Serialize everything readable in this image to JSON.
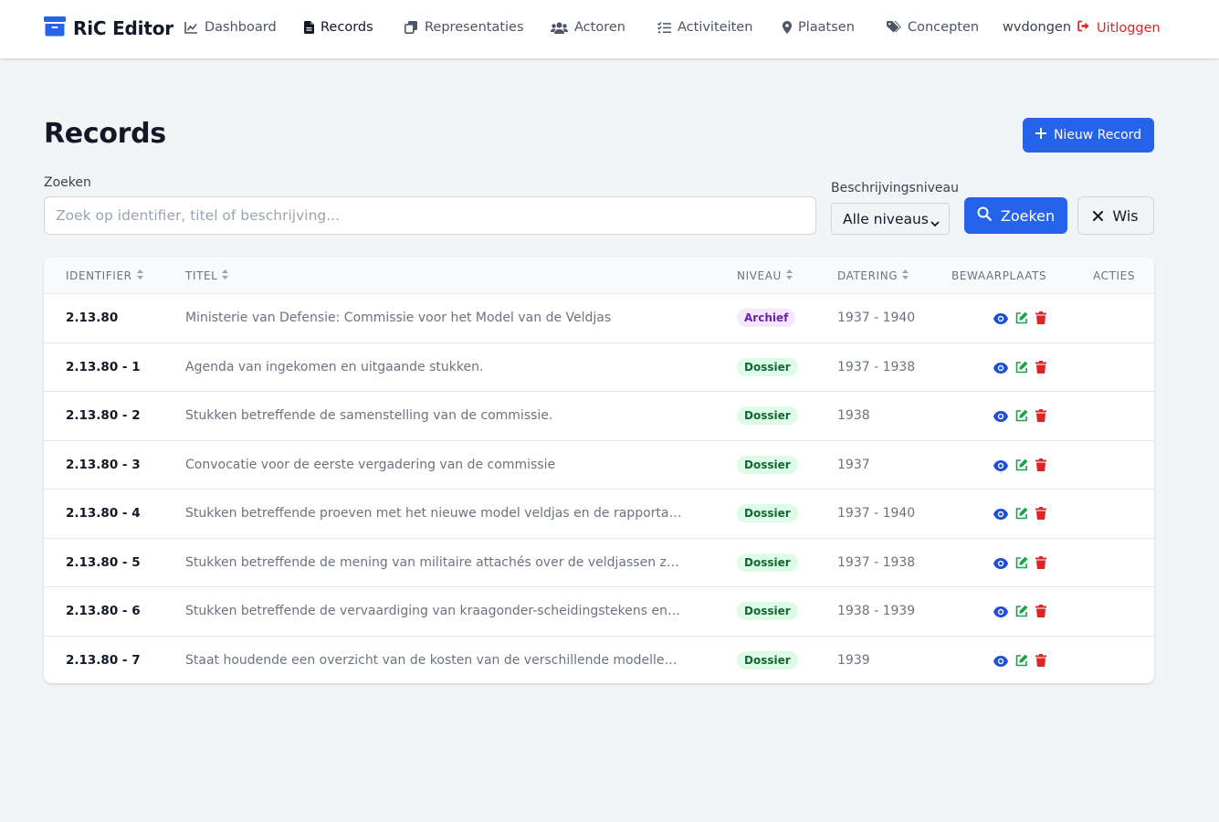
{
  "app": {
    "brand": "RiC Editor",
    "brand_color": "#2563eb"
  },
  "nav": {
    "items": [
      {
        "label": "Dashboard",
        "icon": "chart-line-icon"
      },
      {
        "label": "Records",
        "icon": "file-icon",
        "active": true
      },
      {
        "label": "Representaties",
        "icon": "copy-icon"
      },
      {
        "label": "Actoren",
        "icon": "users-icon"
      },
      {
        "label": "Activiteiten",
        "icon": "list-check-icon"
      },
      {
        "label": "Plaatsen",
        "icon": "map-marker-icon"
      },
      {
        "label": "Concepten",
        "icon": "tags-icon"
      }
    ],
    "username": "wvdongen",
    "logout_label": "Uitloggen"
  },
  "page": {
    "title": "Records",
    "new_button_label": "Nieuw Record"
  },
  "filters": {
    "search_label": "Zoeken",
    "search_placeholder": "Zoek op identifier, titel of beschrijving...",
    "search_value": "",
    "level_label": "Beschrijvingsniveau",
    "level_selected": "Alle niveaus",
    "search_button_label": "Zoeken",
    "clear_button_label": "Wis"
  },
  "table": {
    "headers": {
      "identifier": "IDENTIFIER",
      "titel": "TITEL",
      "niveau": "NIVEAU",
      "datering": "DATERING",
      "bewaarplaats": "BEWAARPLAATS",
      "acties": "ACTIES"
    },
    "rows": [
      {
        "identifier": "2.13.80",
        "titel": "Ministerie van Defensie: Commissie voor het Model van de Veldjas",
        "niveau": "Archief",
        "datering": "1937 - 1940"
      },
      {
        "identifier": "2.13.80 - 1",
        "titel": "Agenda van ingekomen en uitgaande stukken.",
        "niveau": "Dossier",
        "datering": "1937 - 1938"
      },
      {
        "identifier": "2.13.80 - 2",
        "titel": "Stukken betreffende de samenstelling van de commissie.",
        "niveau": "Dossier",
        "datering": "1938"
      },
      {
        "identifier": "2.13.80 - 3",
        "titel": "Convocatie voor de eerste vergadering van de commissie",
        "niveau": "Dossier",
        "datering": "1937"
      },
      {
        "identifier": "2.13.80 - 4",
        "titel": "Stukken betreffende proeven met het nieuwe model veldjas en de rapportage daarv…",
        "niveau": "Dossier",
        "datering": "1937 - 1940"
      },
      {
        "identifier": "2.13.80 - 5",
        "titel": "Stukken betreffende de mening van militaire attachés over de veldjassen zoals d…",
        "niveau": "Dossier",
        "datering": "1937 - 1938"
      },
      {
        "identifier": "2.13.80 - 6",
        "titel": "Stukken betreffende de vervaardiging van kraagonder-scheidingstekens en galons.",
        "niveau": "Dossier",
        "datering": "1938 - 1939"
      },
      {
        "identifier": "2.13.80 - 7",
        "titel": "Staat houdende een overzicht van de kosten van de verschillende modellen veldja…",
        "niveau": "Dossier",
        "datering": "1939"
      }
    ]
  },
  "colors": {
    "primary": "#2563eb",
    "danger": "#dc2626",
    "view": "#1d4ed8",
    "edit": "#16a34a",
    "delete": "#dc2626",
    "archief_badge": "#f3e8ff",
    "dossier_badge": "#dcfce7"
  }
}
